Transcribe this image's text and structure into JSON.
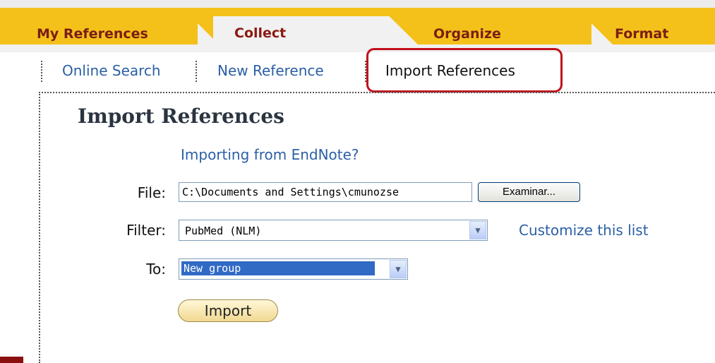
{
  "tabs": [
    "My References",
    "Collect",
    "Organize",
    "Format"
  ],
  "subnav": {
    "online_search": "Online Search",
    "new_reference": "New Reference",
    "import_references": "Import References"
  },
  "page": {
    "title": "Import References",
    "endnote_link": "Importing from EndNote?"
  },
  "form": {
    "file_label": "File:",
    "file_value": "C:\\Documents and Settings\\cmunozse",
    "browse_label": "Examinar...",
    "filter_label": "Filter:",
    "filter_value": "PubMed (NLM)",
    "customize_link": "Customize this list",
    "to_label": "To:",
    "to_value": "New group",
    "import_label": "Import"
  },
  "colors": {
    "tab_band": "#f4c11b",
    "tab_text": "#7a1e14",
    "link": "#2b5fa5",
    "highlight": "#c0101a",
    "selection": "#316ac5"
  }
}
